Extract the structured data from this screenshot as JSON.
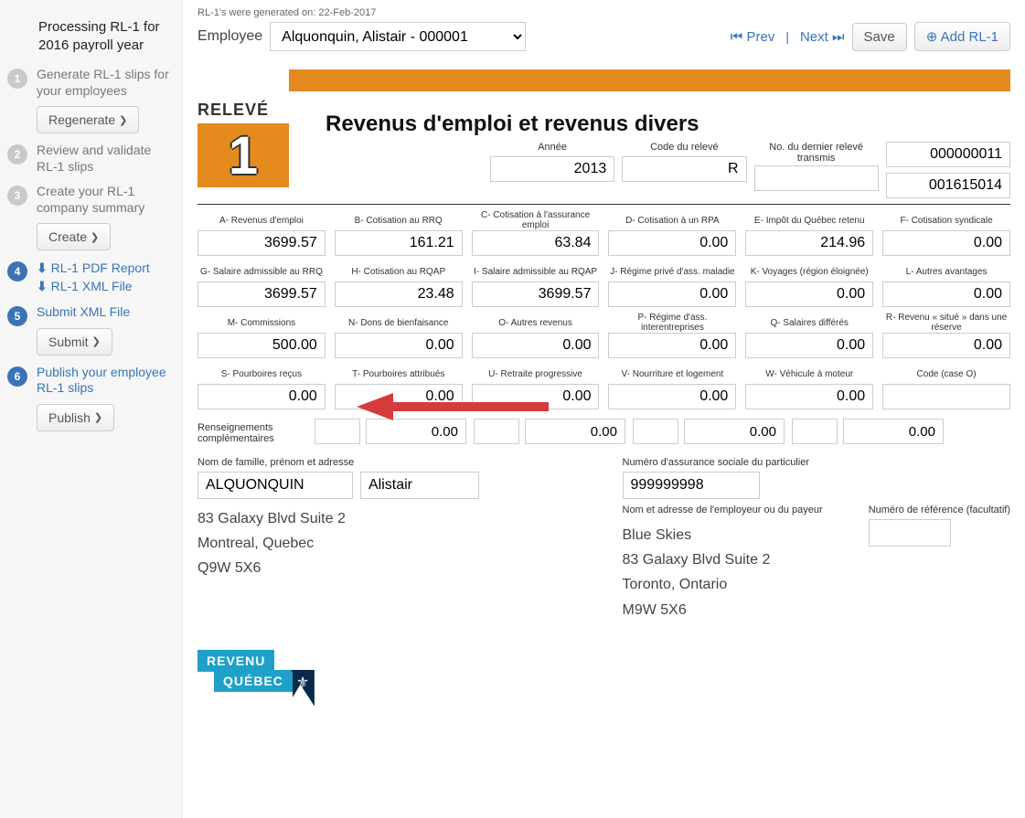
{
  "sidebar": {
    "header": "Processing RL-1 for 2016 payroll year",
    "steps": [
      {
        "n": "1",
        "title": "Generate RL-1 slips for your employees",
        "btn": "Regenerate"
      },
      {
        "n": "2",
        "title": "Review and validate RL-1 slips"
      },
      {
        "n": "3",
        "title": "Create your RL-1 company summary",
        "btn": "Create"
      },
      {
        "n": "4",
        "links": [
          "RL-1 PDF Report",
          "RL-1 XML File"
        ]
      },
      {
        "n": "5",
        "title": "Submit XML File",
        "btn": "Submit"
      },
      {
        "n": "6",
        "title": "Publish your employee RL-1 slips",
        "btn": "Publish"
      }
    ]
  },
  "topnote": "RL-1's were generated on: 22-Feb-2017",
  "employee_label": "Employee",
  "employee_selected": "Alquonquin, Alistair - 000001",
  "nav": {
    "prev": "Prev",
    "next": "Next",
    "save": "Save",
    "add": "Add RL-1"
  },
  "form": {
    "releve": "RELEVÉ",
    "one": "1",
    "title": "Revenus d'emploi et revenus divers",
    "top": {
      "annee_lab": "Année",
      "annee": "2013",
      "code_lab": "Code du relevé",
      "code": "R",
      "dernier_lab": "No. du dernier relevé transmis",
      "dernier": "",
      "seq1": "000000011",
      "seq2": "001615014"
    },
    "boxes": [
      [
        "A- Revenus d'emploi",
        "3699.57"
      ],
      [
        "B- Cotisation au RRQ",
        "161.21"
      ],
      [
        "C- Cotisation à l'assurance emploi",
        "63.84"
      ],
      [
        "D- Cotisation à un RPA",
        "0.00"
      ],
      [
        "E- Impôt du Québec retenu",
        "214.96"
      ],
      [
        "F- Cotisation syndicale",
        "0.00"
      ],
      [
        "G- Salaire admissible au RRQ",
        "3699.57"
      ],
      [
        "H- Cotisation au RQAP",
        "23.48"
      ],
      [
        "I- Salaire admissible au RQAP",
        "3699.57"
      ],
      [
        "J- Régime privé d'ass. maladie",
        "0.00"
      ],
      [
        "K- Voyages (région éloignée)",
        "0.00"
      ],
      [
        "L- Autres avantages",
        "0.00"
      ],
      [
        "M- Commissions",
        "500.00"
      ],
      [
        "N- Dons de bienfaisance",
        "0.00"
      ],
      [
        "O- Autres revenus",
        "0.00"
      ],
      [
        "P- Régime d'ass. interentreprises",
        "0.00"
      ],
      [
        "Q- Salaires différés",
        "0.00"
      ],
      [
        "R- Revenu « situé » dans une réserve",
        "0.00"
      ],
      [
        "S- Pourboires reçus",
        "0.00"
      ],
      [
        "T- Pourboires attribués",
        "0.00"
      ],
      [
        "U- Retraite progressive",
        "0.00"
      ],
      [
        "V- Nourriture et logement",
        "0.00"
      ],
      [
        "W- Véhicule à moteur",
        "0.00"
      ],
      [
        "Code (case O)",
        ""
      ]
    ],
    "rens_lab": "Renseignements complémentaires",
    "rens": [
      [
        "",
        "0.00"
      ],
      [
        "",
        "0.00"
      ],
      [
        "",
        "0.00"
      ],
      [
        "",
        "0.00"
      ]
    ],
    "name_lab": "Nom de famille, prénom et adresse",
    "lastname": "ALQUONQUIN",
    "firstname": "Alistair",
    "addr": [
      "83 Galaxy Blvd Suite 2",
      "Montreal, Quebec",
      "Q9W 5X6"
    ],
    "sin_lab": "Numéro d'assurance sociale du particulier",
    "sin": "999999998",
    "emp_lab": "Nom et adresse de l'employeur ou du payeur",
    "ref_lab": "Numéro de référence (facultatif)",
    "employer": [
      "Blue Skies",
      "83 Galaxy Blvd Suite 2",
      "Toronto, Ontario",
      "M9W 5X6"
    ],
    "rq1": "REVENU",
    "rq2": "QUÉBEC"
  }
}
